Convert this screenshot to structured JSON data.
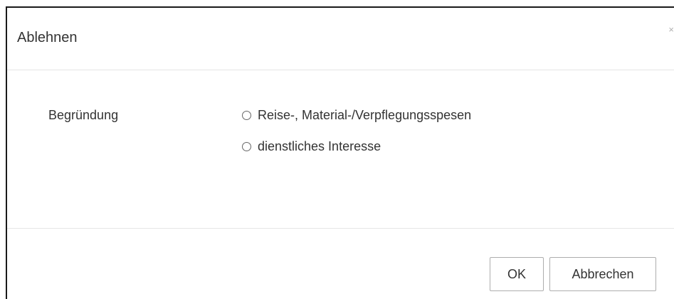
{
  "dialog": {
    "title": "Ablehnen",
    "close_symbol": "×"
  },
  "form": {
    "field_label": "Begründung",
    "options": [
      {
        "label": "Reise-, Material-/Verpflegungsspesen",
        "selected": false
      },
      {
        "label": "dienstliches Interesse",
        "selected": false
      }
    ]
  },
  "footer": {
    "ok_label": "OK",
    "cancel_label": "Abbrechen"
  },
  "icons": {
    "close": "close-icon",
    "radio": "radio-circle"
  },
  "colors": {
    "text": "#333333",
    "divider": "#e5e5e5",
    "button_border": "#adadad"
  }
}
